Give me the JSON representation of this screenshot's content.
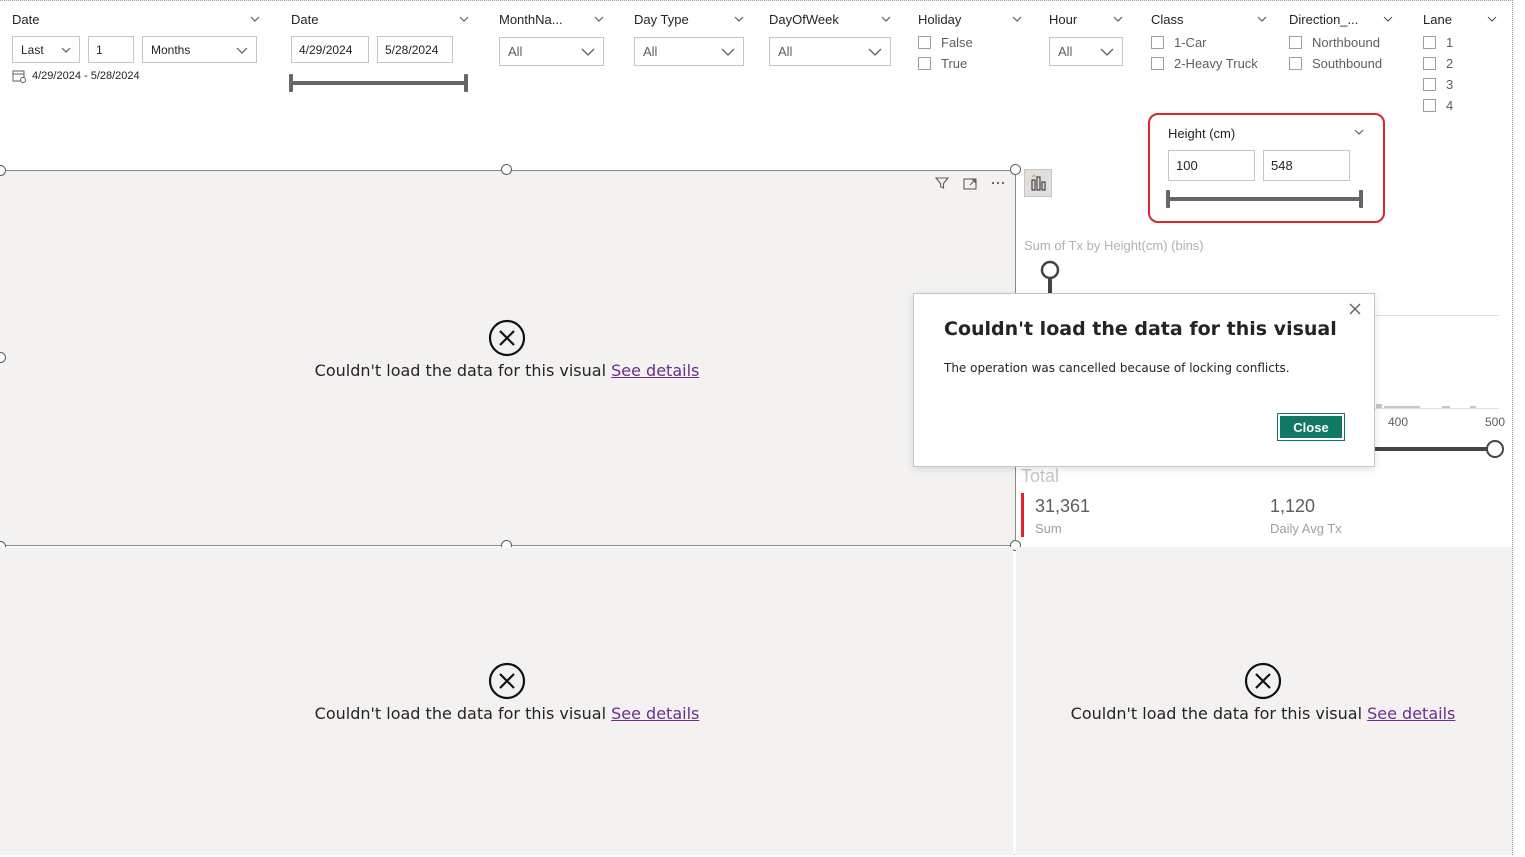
{
  "slicers": {
    "date_relative": {
      "title": "Date",
      "mode": "Last",
      "count": "1",
      "unit": "Months",
      "range_text": "4/29/2024 - 5/28/2024"
    },
    "date_range": {
      "title": "Date",
      "start": "4/29/2024",
      "end": "5/28/2024"
    },
    "month_name": {
      "title": "MonthNa...",
      "value": "All"
    },
    "day_type": {
      "title": "Day Type",
      "value": "All"
    },
    "day_of_week": {
      "title": "DayOfWeek",
      "value": "All"
    },
    "holiday": {
      "title": "Holiday",
      "options": [
        "False",
        "True"
      ]
    },
    "hour": {
      "title": "Hour",
      "value": "All"
    },
    "class": {
      "title": "Class",
      "options": [
        "1-Car",
        "2-Heavy Truck"
      ]
    },
    "direction": {
      "title": "Direction_...",
      "options": [
        "Northbound",
        "Southbound"
      ]
    },
    "lane": {
      "title": "Lane",
      "options": [
        "1",
        "2",
        "3",
        "4"
      ]
    },
    "height": {
      "title": "Height (cm)",
      "min": "100",
      "max": "548"
    }
  },
  "errors": {
    "message": "Couldn't load the data for this visual",
    "link": "See details"
  },
  "chart": {
    "title": "Sum of Tx by Height(cm) (bins)",
    "tick_400": "400",
    "tick_500": "500",
    "total_label": "Total",
    "kpi1_value": "31,361",
    "kpi1_label": "Sum",
    "kpi2_value": "1,120",
    "kpi2_label": "Daily Avg Tx"
  },
  "modal": {
    "title": "Couldn't load the data for this visual",
    "body": "The operation was cancelled because of locking conflicts.",
    "close_label": "Close"
  },
  "colors": {
    "accent_button": "#117865",
    "highlight_border": "#e0242f",
    "link": "#6b2d8f",
    "visual_bg": "#f3f2f1"
  }
}
